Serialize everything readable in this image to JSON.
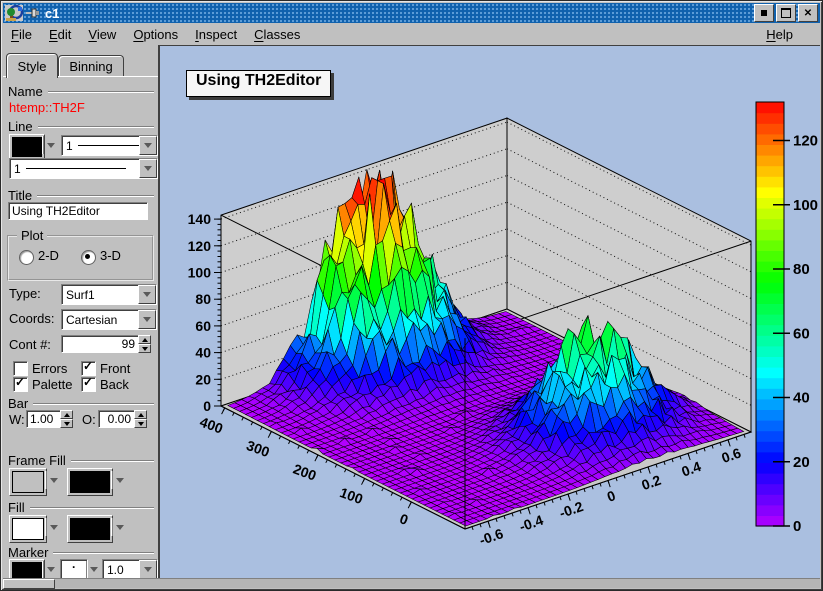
{
  "window": {
    "title": "c1",
    "buttons": {
      "minimize": "iconify",
      "maximize": "maximize",
      "close": "close"
    }
  },
  "menubar": {
    "items": [
      {
        "label": "File"
      },
      {
        "label": "Edit"
      },
      {
        "label": "View"
      },
      {
        "label": "Options"
      },
      {
        "label": "Inspect"
      },
      {
        "label": "Classes"
      }
    ],
    "right_item": {
      "label": "Help"
    }
  },
  "editor": {
    "tabs": [
      {
        "label": "Style",
        "active": true
      },
      {
        "label": "Binning",
        "active": false
      }
    ],
    "name_section": {
      "label": "Name",
      "value": "htemp::TH2F",
      "value_color": "#ff0000"
    },
    "line_section": {
      "label": "Line",
      "color_value": "#000000",
      "style_value": "1",
      "width_value": "1"
    },
    "title_section": {
      "label": "Title",
      "value": "Using TH2Editor"
    },
    "plot_group": {
      "label": "Plot",
      "options": [
        {
          "label": "2-D",
          "selected": false
        },
        {
          "label": "3-D",
          "selected": true
        }
      ]
    },
    "type_row": {
      "label": "Type:",
      "value": "Surf1"
    },
    "coords_row": {
      "label": "Coords:",
      "value": "Cartesian"
    },
    "cont_row": {
      "label": "Cont #:",
      "value": "99"
    },
    "checkboxes": [
      {
        "label": "Errors",
        "checked": false
      },
      {
        "label": "Front",
        "checked": true
      },
      {
        "label": "Palette",
        "checked": true
      },
      {
        "label": "Back",
        "checked": true
      }
    ],
    "bar_section": {
      "label": "Bar",
      "w_label": "W:",
      "w_value": "1.00",
      "o_label": "O:",
      "o_value": "0.00"
    },
    "frame_fill_section": {
      "label": "Frame Fill",
      "color_value": "#c0c0c0",
      "pattern_value": "#000000"
    },
    "fill_section": {
      "label": "Fill",
      "color_value": "#ffffff",
      "pattern_value": "#000000"
    },
    "marker_section": {
      "label": "Marker",
      "color_value": "#000000",
      "style_glyph": "·",
      "size_value": "1.0"
    }
  },
  "canvas": {
    "background": "#aabfe0",
    "title_label": "Using TH2Editor"
  },
  "chart_data": {
    "type": "surface3d",
    "title": "Using TH2Editor",
    "draw_option": "SURF1",
    "coords": "Cartesian",
    "x_axis": {
      "min": -0.715,
      "max": 0.715,
      "tick_values": [
        -0.6,
        -0.4,
        -0.2,
        0,
        0.2,
        0.4,
        0.6
      ],
      "tick_labels": [
        "-0.6",
        "-0.4",
        "-0.2",
        "0",
        "0.2",
        "0.4",
        "0.6"
      ],
      "minor_step": 0.04
    },
    "y_axis": {
      "min": -115,
      "max": 408,
      "tick_values": [
        0,
        100,
        200,
        300,
        400
      ],
      "tick_labels": [
        "0",
        "100",
        "200",
        "300",
        "400"
      ],
      "minor_step": 20
    },
    "z_axis": {
      "min": 0,
      "max": 143,
      "tick_values": [
        0,
        20,
        40,
        60,
        80,
        100,
        120,
        140
      ],
      "tick_labels": [
        "0",
        "20",
        "40",
        "60",
        "80",
        "100",
        "120",
        "140"
      ],
      "minor_step": 4
    },
    "palette": {
      "min": 0,
      "max": 132,
      "tick_values": [
        0,
        20,
        40,
        60,
        80,
        100,
        120
      ],
      "tick_labels": [
        "0",
        "20",
        "40",
        "60",
        "80",
        "100",
        "120"
      ],
      "position": "right",
      "bands": 40
    },
    "color_scale": {
      "type": "rainbow",
      "hue_start": 283,
      "hue_end": 0
    },
    "walls": {
      "color": "#cecece",
      "grid_style": "dotted"
    },
    "surface": {
      "grid_nx": 40,
      "grid_ny": 40,
      "x_range": [
        -0.695,
        0.695
      ],
      "y_range": [
        -108,
        402
      ],
      "peaks": [
        {
          "amplitude": 138,
          "x": -0.02,
          "y": 380,
          "sigma_x": 0.2,
          "sigma_y": 60
        },
        {
          "amplitude": 70,
          "x": 0.25,
          "y": 25,
          "sigma_x": 0.19,
          "sigma_y": 55
        }
      ],
      "noise": {
        "seed": 1337,
        "amplitude": 0.28
      },
      "z_clip": 142
    }
  }
}
